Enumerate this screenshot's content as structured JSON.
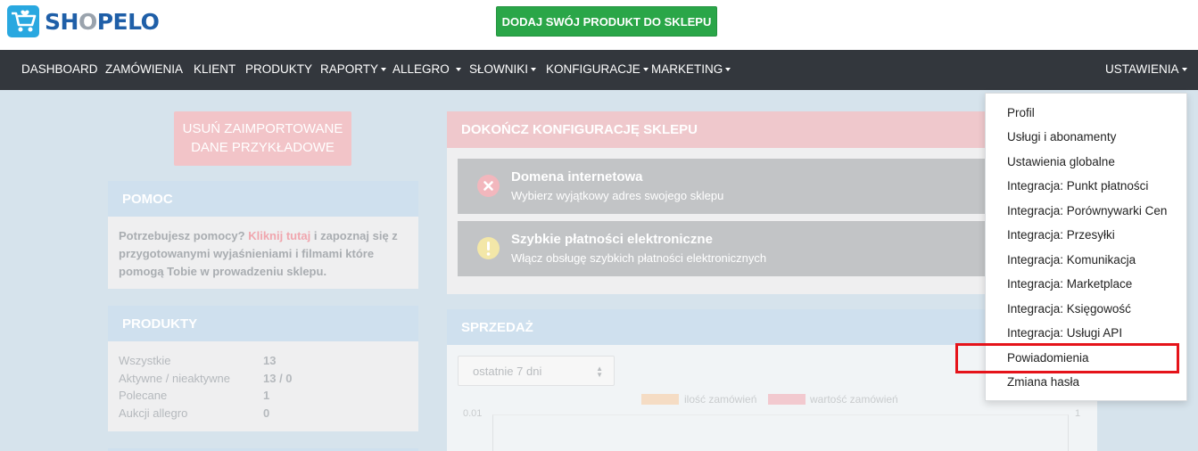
{
  "header": {
    "logo_text": "SHOPELO",
    "logo_o": "O",
    "logo_start": "SH",
    "logo_end": "PELO",
    "add_product_label": "DODAJ SWÓJ PRODUKT DO SKLEPU"
  },
  "nav": {
    "items": [
      {
        "label": "DASHBOARD"
      },
      {
        "label": "ZAMÓWIENIA"
      },
      {
        "label": "KLIENT"
      },
      {
        "label": "PRODUKTY"
      },
      {
        "label": "RAPORTY"
      },
      {
        "label": "ALLEGRO"
      },
      {
        "label": "SŁOWNIKI"
      },
      {
        "label": "KONFIGURACJE"
      },
      {
        "label": "MARKETING"
      }
    ],
    "settings_label": "USTAWIENIA"
  },
  "delete_demo": {
    "line1": "USUŃ ZAIMPORTOWANE",
    "line2": "DANE PRZYKŁADOWE"
  },
  "help": {
    "title": "POMOC",
    "text_before": "Potrzebujesz pomocy? ",
    "link": "Kliknij tutaj",
    "text_after": " i zapoznaj się z przygotowanymi wyjaśnieniami i filmami które pomogą Tobie w prowadzeniu sklepu."
  },
  "products": {
    "title": "PRODUKTY",
    "rows": [
      {
        "label": "Wszystkie",
        "value": "13"
      },
      {
        "label": "Aktywne / nieaktywne",
        "value": "13 / 0"
      },
      {
        "label": "Polecane",
        "value": "1"
      },
      {
        "label": "Aukcji allegro",
        "value": "0"
      }
    ]
  },
  "config": {
    "title": "DOKOŃCZ KONFIGURACJĘ SKLEPU",
    "items": [
      {
        "title": "Domena internetowa",
        "subtitle": "Wybierz wyjątkowy adres swojego sklepu",
        "icon": "error-x-icon",
        "color": "#f2b7bd"
      },
      {
        "title": "Szybkie płatności elektroniczne",
        "subtitle": "Włącz obsługę szybkich płatności elektronicznych",
        "icon": "warning-exclamation-icon",
        "color": "#f3e7a8"
      }
    ]
  },
  "sales": {
    "title": "SPRZEDAŻ",
    "period": "ostatnie 7 dni",
    "legend": [
      {
        "label": "ilość zamówień",
        "color": "#f5dcc4"
      },
      {
        "label": "wartość zamówień",
        "color": "#f2c9cf"
      }
    ],
    "y_left_top": "0.01",
    "y_right_top": "1"
  },
  "settings_menu": {
    "items": [
      {
        "label": "Profil"
      },
      {
        "label": "Usługi i abonamenty"
      },
      {
        "label": "Ustawienia globalne"
      },
      {
        "label": "Integracja: Punkt płatności"
      },
      {
        "label": "Integracja: Porównywarki Cen"
      },
      {
        "label": "Integracja: Przesyłki"
      },
      {
        "label": "Integracja: Komunikacja"
      },
      {
        "label": "Integracja: Marketplace"
      },
      {
        "label": "Integracja: Księgowość"
      },
      {
        "label": "Integracja: Usługi API"
      },
      {
        "label": "Powiadomienia"
      },
      {
        "label": "Zmiana hasła"
      }
    ],
    "highlighted_index": 10
  },
  "colors": {
    "nav_bg": "#33373d",
    "add_button": "#2aa648",
    "brand": "#1f5fa8",
    "highlight": "#e5131a"
  }
}
